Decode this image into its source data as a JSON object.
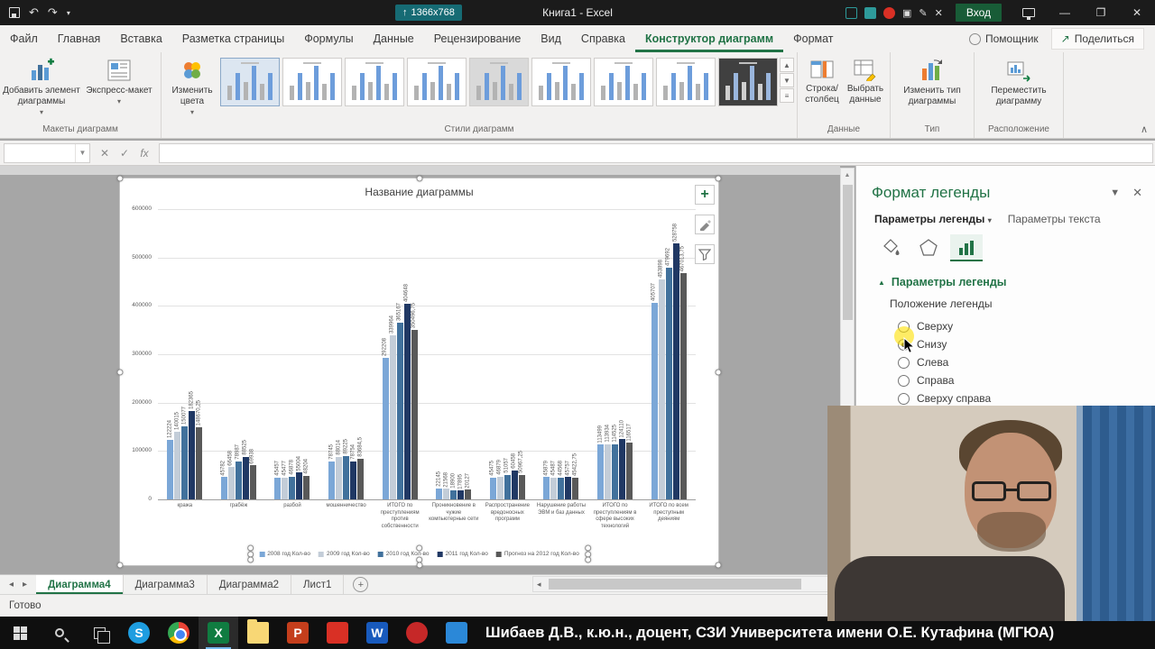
{
  "titlebar": {
    "resolution_badge": "1366x768",
    "title": "Книга1  -  Excel",
    "signin": "Вход"
  },
  "ribbon_tabs": {
    "tabs": [
      "Файл",
      "Главная",
      "Вставка",
      "Разметка страницы",
      "Формулы",
      "Данные",
      "Рецензирование",
      "Вид",
      "Справка",
      "Конструктор диаграмм",
      "Формат"
    ],
    "active_tab": "Конструктор диаграмм",
    "assistant": "Помощник",
    "share": "Поделиться"
  },
  "ribbon": {
    "buttons": {
      "add_element": "Добавить элемент диаграммы",
      "quick_layout": "Экспресс-макет",
      "change_colors": "Изменить цвета",
      "row_column": "Строка/ столбец",
      "select_data": "Выбрать данные",
      "change_type": "Изменить тип диаграммы",
      "move_chart": "Переместить диаграмму"
    },
    "group_labels": [
      "Макеты диаграмм",
      "Стили диаграмм",
      "Данные",
      "Тип",
      "Расположение"
    ],
    "style_gallery_count": 9
  },
  "formula_bar": {
    "fx_label": "fx",
    "name_box_value": ""
  },
  "chart_data": {
    "type": "bar",
    "title": "Название диаграммы",
    "ylim": [
      0,
      600000
    ],
    "ytick_step": 100000,
    "yticks": [
      0,
      100000,
      200000,
      300000,
      400000,
      500000,
      600000
    ],
    "grid": true,
    "legend_position": "bottom",
    "categories": [
      "кража",
      "грабёж",
      "разбой",
      "мошенничество",
      "ИТОГО по преступлениям против собственности",
      "Проникновение в чужие компьютерные сети",
      "Распространение вредоносных программ",
      "Нарушение работы ЭВМ и баз данных",
      "ИТОГО по преступлениям в сфере высоких технологий",
      "ИТОГО по всем преступным деяниям"
    ],
    "series": [
      {
        "name": "2008 год Кол-во",
        "color": "#7ba7d7",
        "values": [
          122224,
          45782,
          45457,
          78745,
          292208,
          22145,
          45475,
          45879,
          113499,
          405707
        ]
      },
      {
        "name": "2009 год Кол-во",
        "color": "#c3cdd8",
        "values": [
          140015,
          66458,
          45477,
          88014,
          339964,
          21568,
          46879,
          45487,
          113934,
          453898
        ]
      },
      {
        "name": "2010 год Кол-во",
        "color": "#41719c",
        "values": [
          150077,
          78987,
          46878,
          89225,
          365167,
          18900,
          51057,
          44568,
          114525,
          479692
        ]
      },
      {
        "name": "2011 год Кол-во",
        "color": "#203864",
        "values": [
          182365,
          88525,
          55004,
          78754,
          404648,
          17895,
          60458,
          45757,
          124110,
          528758
        ]
      },
      {
        "name": "Прогноз на 2012 год Кол-во",
        "color": "#595959",
        "values": [
          148670.25,
          69938,
          48204,
          83684.5,
          350496.75,
          20127,
          50967.25,
          45422.75,
          116517,
          467013.75
        ]
      }
    ]
  },
  "format_pane": {
    "title": "Формат легенды",
    "tab_legend": "Параметры легенды",
    "tab_text": "Параметры текста",
    "section_header": "Параметры легенды",
    "position_label": "Положение легенды",
    "options": [
      {
        "label": "Сверху",
        "checked": false
      },
      {
        "label": "Снизу",
        "checked": true
      },
      {
        "label": "Слева",
        "checked": false
      },
      {
        "label": "Справа",
        "checked": false
      },
      {
        "label": "Сверху справа",
        "checked": false
      }
    ]
  },
  "sheet_tabs": {
    "tabs": [
      "Диаграмма4",
      "Диаграмма3",
      "Диаграмма2",
      "Лист1"
    ],
    "active": "Диаграмма4"
  },
  "status_bar": {
    "ready": "Готово"
  },
  "taskbar": {
    "caption": "Шибаев Д.В., к.ю.н., доцент, СЗИ Университета имени О.Е. Кутафина (МГЮА)",
    "apps": [
      {
        "name": "skype-icon",
        "glyph": "S",
        "bg": "#1e9de0",
        "shape": "circle"
      },
      {
        "name": "chrome-icon",
        "glyph": "",
        "bg": "",
        "shape": "chrome"
      },
      {
        "name": "excel-icon",
        "glyph": "X",
        "bg": "#107c41",
        "shape": "square",
        "active": true
      },
      {
        "name": "file-explorer-icon",
        "glyph": "",
        "bg": "#f8d775",
        "shape": "folder"
      },
      {
        "name": "powerpoint-icon",
        "glyph": "P",
        "bg": "#c43e1c",
        "shape": "square"
      },
      {
        "name": "red-app-icon",
        "glyph": "",
        "bg": "#d93025",
        "shape": "square"
      },
      {
        "name": "word-icon",
        "glyph": "W",
        "bg": "#185abd",
        "shape": "square"
      },
      {
        "name": "record-app-icon",
        "glyph": "",
        "bg": "#c62828",
        "shape": "circle"
      },
      {
        "name": "camera-app-icon",
        "glyph": "",
        "bg": "#2b88d8",
        "shape": "square"
      }
    ]
  }
}
